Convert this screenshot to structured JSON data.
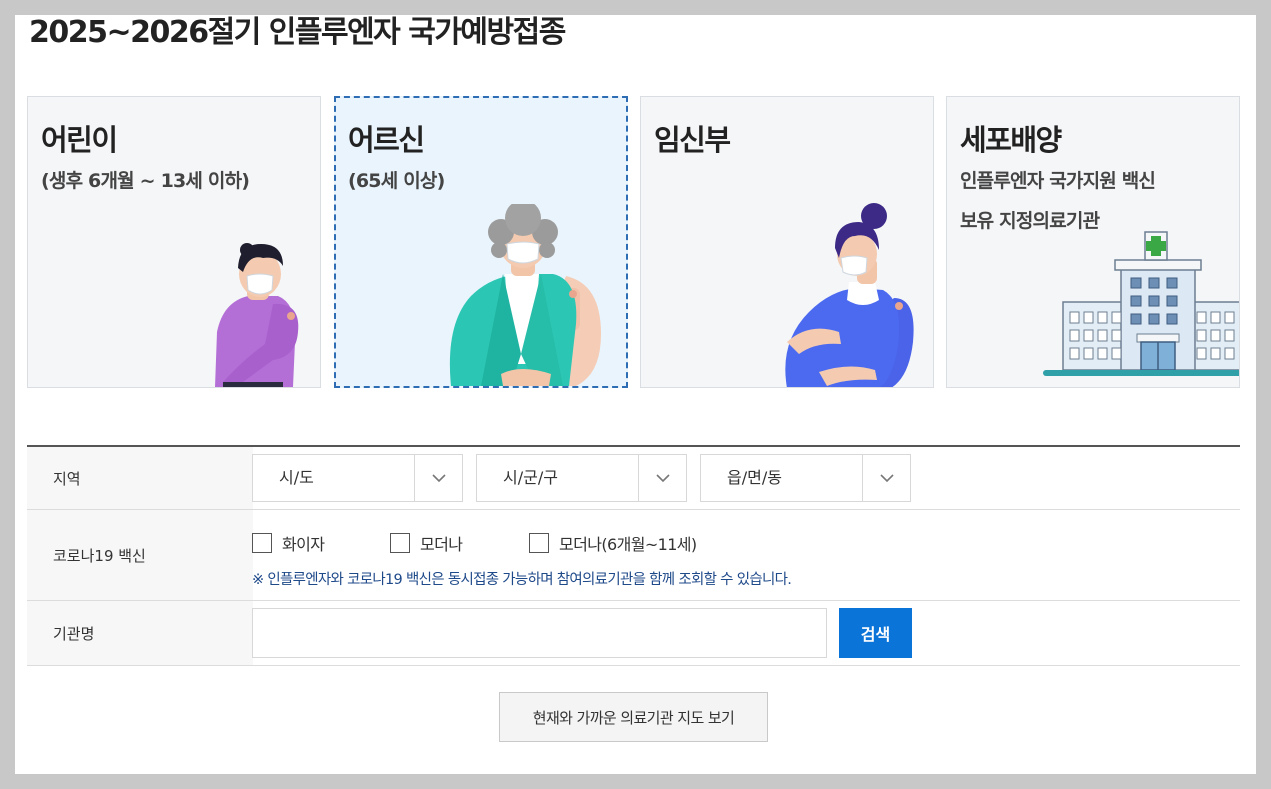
{
  "page": {
    "title": "2025~2026절기 인플루엔자 국가예방접종"
  },
  "cards": [
    {
      "title": "어린이",
      "subtitle": "(생후 6개월 ~ 13세 이하)",
      "selected": false
    },
    {
      "title": "어르신",
      "subtitle": "(65세 이상)",
      "selected": true
    },
    {
      "title": "임신부",
      "subtitle": "",
      "selected": false
    },
    {
      "title": "세포배양",
      "subtitle_line1": "인플루엔자 국가지원 백신",
      "subtitle_line2": "보유 지정의료기관",
      "selected": false
    }
  ],
  "form": {
    "region": {
      "label": "지역",
      "selects": [
        "시/도",
        "시/군/구",
        "읍/면/동"
      ]
    },
    "covid": {
      "label": "코로나19 백신",
      "options": [
        "화이자",
        "모더나",
        "모더나(6개월~11세)"
      ],
      "notice": "※ 인플루엔자와 코로나19 백신은 동시접종 가능하며 참여의료기관을 함께 조회할 수 있습니다."
    },
    "institution": {
      "label": "기관명",
      "value": "",
      "search_label": "검색"
    }
  },
  "map_button_label": "현재와 가까운 의료기관 지도 보기",
  "colors": {
    "accent": "#0a74d8",
    "selected_border": "#2e6db4",
    "notice_text": "#1f4a8a"
  }
}
